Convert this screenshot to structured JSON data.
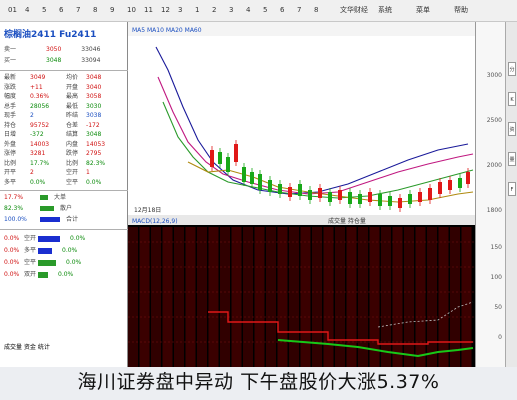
{
  "toolbar": {
    "items": [
      "01",
      "4",
      "5",
      "6",
      "7",
      "8",
      "9",
      "10",
      "11",
      "12",
      "3",
      "1",
      "2",
      "3",
      "4",
      "5",
      "6",
      "7",
      "8"
    ],
    "right_labels": [
      "文华财经",
      "系统",
      "菜单",
      "帮助"
    ]
  },
  "panel": {
    "title": "棕榈油2411  Fu2411",
    "quote": [
      {
        "label": "卖一",
        "price": "3050",
        "vol": "33046",
        "cls": "red"
      },
      {
        "label": "买一",
        "price": "3048",
        "vol": "33094",
        "cls": "green"
      }
    ],
    "stats": [
      {
        "label": "最新",
        "value": "3049",
        "label2": "均价",
        "value2": "3048",
        "cls": "red"
      },
      {
        "label": "涨跌",
        "value": "+11",
        "label2": "开盘",
        "value2": "3040",
        "cls": "red"
      },
      {
        "label": "幅度",
        "value": "0.36%",
        "label2": "最高",
        "value2": "3058",
        "cls": "red"
      },
      {
        "label": "总手",
        "value": "28056",
        "label2": "最低",
        "value2": "3030",
        "cls": "green"
      },
      {
        "label": "现手",
        "value": "2",
        "label2": "昨结",
        "value2": "3038",
        "cls": "blue"
      },
      {
        "label": "持仓",
        "value": "95752",
        "label2": "仓差",
        "value2": "-172",
        "cls": "red"
      },
      {
        "label": "日增",
        "value": "-372",
        "label2": "结算",
        "value2": "3048",
        "cls": "green"
      },
      {
        "label": "外盘",
        "value": "14003",
        "label2": "内盘",
        "value2": "14053",
        "cls": "red"
      },
      {
        "label": "涨停",
        "value": "3281",
        "label2": "跌停",
        "value2": "2795",
        "cls": "red"
      },
      {
        "label": "比例",
        "value": "17.7%",
        "label2": "比例",
        "value2": "82.3%",
        "cls": "green"
      },
      {
        "label": "开平",
        "value": "2",
        "label2": "空开",
        "value2": "1",
        "cls": "red"
      },
      {
        "label": "多平",
        "value": "0.0%",
        "label2": "空平",
        "value2": "0.0%",
        "cls": "green"
      }
    ],
    "flow": [
      {
        "label": "大单",
        "value": "17.7%",
        "cls": "red"
      },
      {
        "label": "散户",
        "value": "82.3%",
        "cls": "green"
      },
      {
        "label": "合计",
        "value": "100.0%",
        "cls": "blue"
      }
    ],
    "positions": [
      {
        "label": "空开",
        "value": "0.0%",
        "bar_color": "#1a2ed0",
        "bar_fraction": 0.55
      },
      {
        "label": "多平",
        "value": "0.0%",
        "bar_color": "#1a2ed0",
        "bar_fraction": 0.35
      },
      {
        "label": "空平",
        "value": "0.0%",
        "bar_color": "#2a9a2a",
        "bar_fraction": 0.45
      },
      {
        "label": "双开",
        "value": "0.0%",
        "bar_color": "#2a9a2a",
        "bar_fraction": 0.25
      }
    ],
    "footer": "成交量 资金 统计"
  },
  "chart": {
    "header_main": "MA5 MA10 MA20 MA60",
    "header_sub": "MACD(12,26,9)",
    "date_label": "12月18日",
    "lower_header": "成交量 持仓量"
  },
  "axis": {
    "upper": [
      "3000",
      "2500",
      "2000",
      "1800"
    ],
    "lower": [
      "150",
      "100",
      "50",
      "0"
    ]
  },
  "sidebar": {
    "tabs": [
      "分",
      "K",
      "资",
      "量",
      "F"
    ]
  },
  "headline": "海川证券盘中异动 下午盘股价大涨5.37%",
  "colors": {
    "chart_bg": "#000000",
    "lower_bg": "#1a0000",
    "up": "#e01818",
    "down": "#18c818"
  }
}
